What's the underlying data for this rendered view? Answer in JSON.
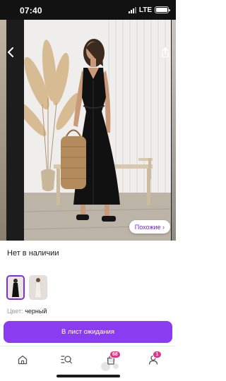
{
  "status_bar": {
    "time": "07:40",
    "network": "LTE"
  },
  "photo": {
    "similar_label": "Похожие ›"
  },
  "product": {
    "availability": "Нет в наличии",
    "color_label": "Цвет:",
    "color_value": "черный"
  },
  "actions": {
    "waitlist_label": "В лист ожидания"
  },
  "tab_bar": {
    "tabs": [
      {
        "name": "home",
        "icon": "home-icon"
      },
      {
        "name": "catalog",
        "icon": "search-list-icon"
      },
      {
        "name": "cart",
        "icon": "cart-icon",
        "badge": "68"
      },
      {
        "name": "profile",
        "icon": "profile-icon",
        "badge": "1"
      }
    ]
  },
  "colors": {
    "accent": "#8a3cf0",
    "badge": "#e2338a",
    "status_bar": "#121212"
  }
}
